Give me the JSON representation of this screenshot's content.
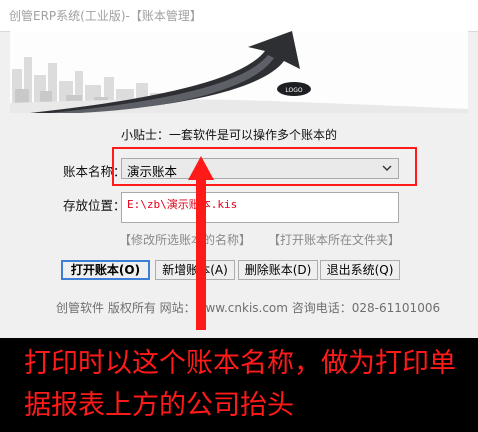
{
  "window": {
    "title": "创管ERP系统(工业版)-【账本管理】"
  },
  "tip": "小贴士：一套软件是可以操作多个账本的",
  "form": {
    "book_name_label": "账本名称：",
    "book_name_value": "演示账本",
    "location_label": "存放位置：",
    "location_value": "E:\\zb\\演示账本.kis"
  },
  "links": {
    "edit_name": "【修改所选账本的名称】",
    "open_folder": "【打开账本所在文件夹】"
  },
  "buttons": {
    "open": "打开账本(O)",
    "add": "新增账本(A)",
    "delete": "删除账本(D)",
    "exit": "退出系统(Q)"
  },
  "footer": "创管软件 版权所有 网站：www.cnkis.com  咨询电话：028-61101006",
  "annotation": {
    "caption": "打印时以这个账本名称，做为打印单据报表上方的公司抬头",
    "color": "#ff1a1a"
  },
  "icons": [
    "banner-arrow-graphic",
    "chevron-down-icon",
    "up-arrow-annotation-icon"
  ]
}
